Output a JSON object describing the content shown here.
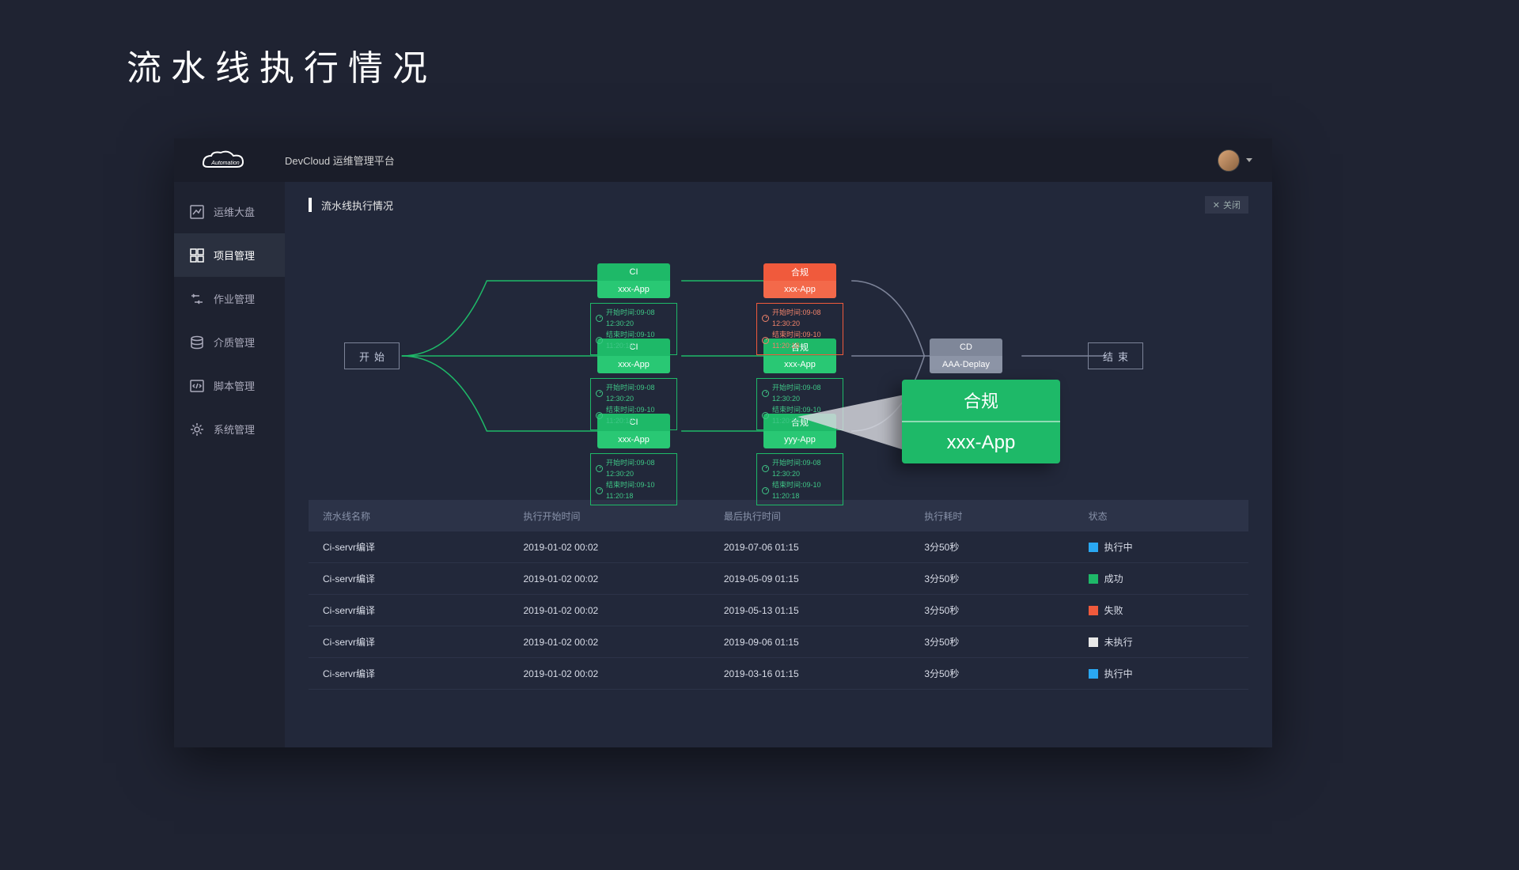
{
  "page_title": "流水线执行情况",
  "header": {
    "logo_text": "Automation",
    "title": "DevCloud 运维管理平台"
  },
  "sidebar": {
    "items": [
      {
        "label": "运维大盘"
      },
      {
        "label": "项目管理"
      },
      {
        "label": "作业管理"
      },
      {
        "label": "介质管理"
      },
      {
        "label": "脚本管理"
      },
      {
        "label": "系统管理"
      }
    ]
  },
  "panel": {
    "title": "流水线执行情况",
    "close": "关闭"
  },
  "flow": {
    "start": "开始",
    "end": "结束",
    "ci_col": [
      {
        "top": "CI",
        "bot": "xxx-App"
      },
      {
        "top": "CI",
        "bot": "xxx-App"
      },
      {
        "top": "CI",
        "bot": "xxx-App"
      }
    ],
    "rule_col": [
      {
        "top": "合规",
        "bot": "xxx-App"
      },
      {
        "top": "合规",
        "bot": "xxx-App"
      },
      {
        "top": "合规",
        "bot": "yyy-App"
      }
    ],
    "cd": {
      "top": "CD",
      "bot": "AAA-Deplay"
    },
    "times": {
      "start_label": "开始时间:09-08 12:30:20",
      "end_label": "结束时间:09-10 11:20:18"
    },
    "callout": {
      "top": "合规",
      "bot": "xxx-App"
    }
  },
  "table": {
    "headers": [
      "流水线名称",
      "执行开始时间",
      "最后执行时间",
      "执行耗时",
      "状态"
    ],
    "rows": [
      {
        "name": "Ci-servr编译",
        "start": "2019-01-02 00:02",
        "last": "2019-07-06 01:15",
        "dur": "3分50秒",
        "status": "执行中",
        "color": "blue"
      },
      {
        "name": "Ci-servr编译",
        "start": "2019-01-02 00:02",
        "last": "2019-05-09 01:15",
        "dur": "3分50秒",
        "status": "成功",
        "color": "green"
      },
      {
        "name": "Ci-servr编译",
        "start": "2019-01-02 00:02",
        "last": "2019-05-13 01:15",
        "dur": "3分50秒",
        "status": "失败",
        "color": "red"
      },
      {
        "name": "Ci-servr编译",
        "start": "2019-01-02 00:02",
        "last": "2019-09-06 01:15",
        "dur": "3分50秒",
        "status": "未执行",
        "color": "white"
      },
      {
        "name": "Ci-servr编译",
        "start": "2019-01-02 00:02",
        "last": "2019-03-16 01:15",
        "dur": "3分50秒",
        "status": "执行中",
        "color": "blue"
      }
    ]
  }
}
